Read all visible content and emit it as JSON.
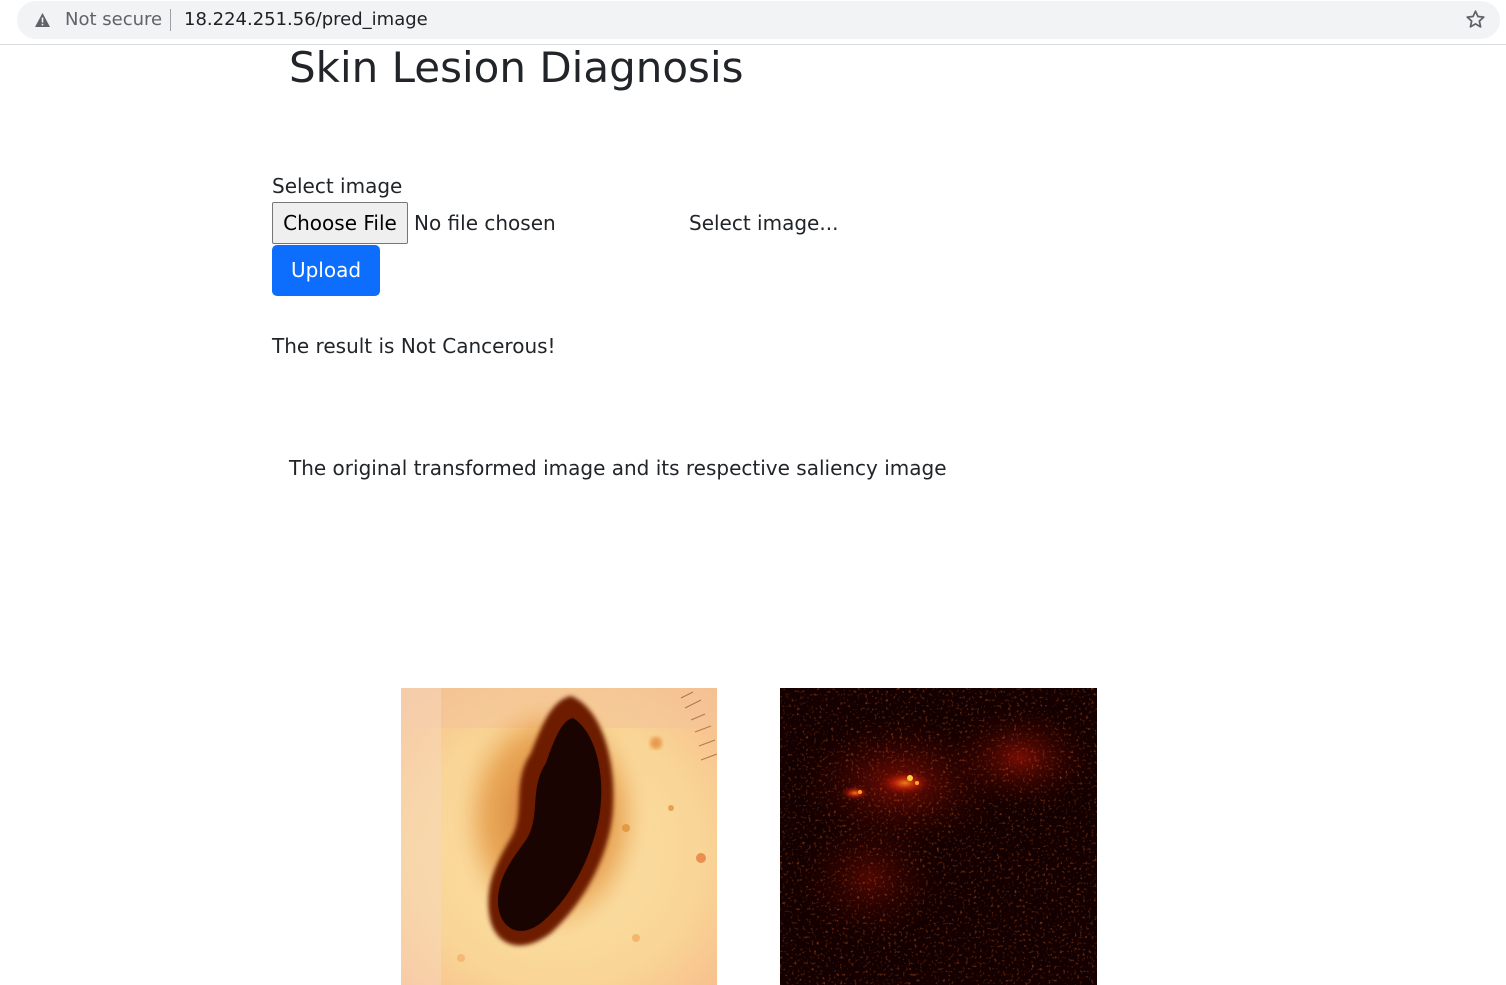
{
  "browser": {
    "security_label": "Not secure",
    "url": "18.224.251.56/pred_image",
    "icons": {
      "warning": "warning-triangle-icon",
      "bookmark": "star-outline-icon"
    }
  },
  "page": {
    "title": "Skin Lesion Diagnosis",
    "form": {
      "label": "Select image",
      "file_button": "Choose File",
      "file_status": "No file chosen",
      "file_hint": "Select image...",
      "submit_label": "Upload",
      "accent_color": "#0d6efd"
    },
    "result_text": "The result is Not Cancerous!",
    "caption": "The original transformed image and its respective saliency image",
    "images": {
      "original": "dermoscopy-lesion-image",
      "saliency": "saliency-heatmap-image"
    }
  }
}
